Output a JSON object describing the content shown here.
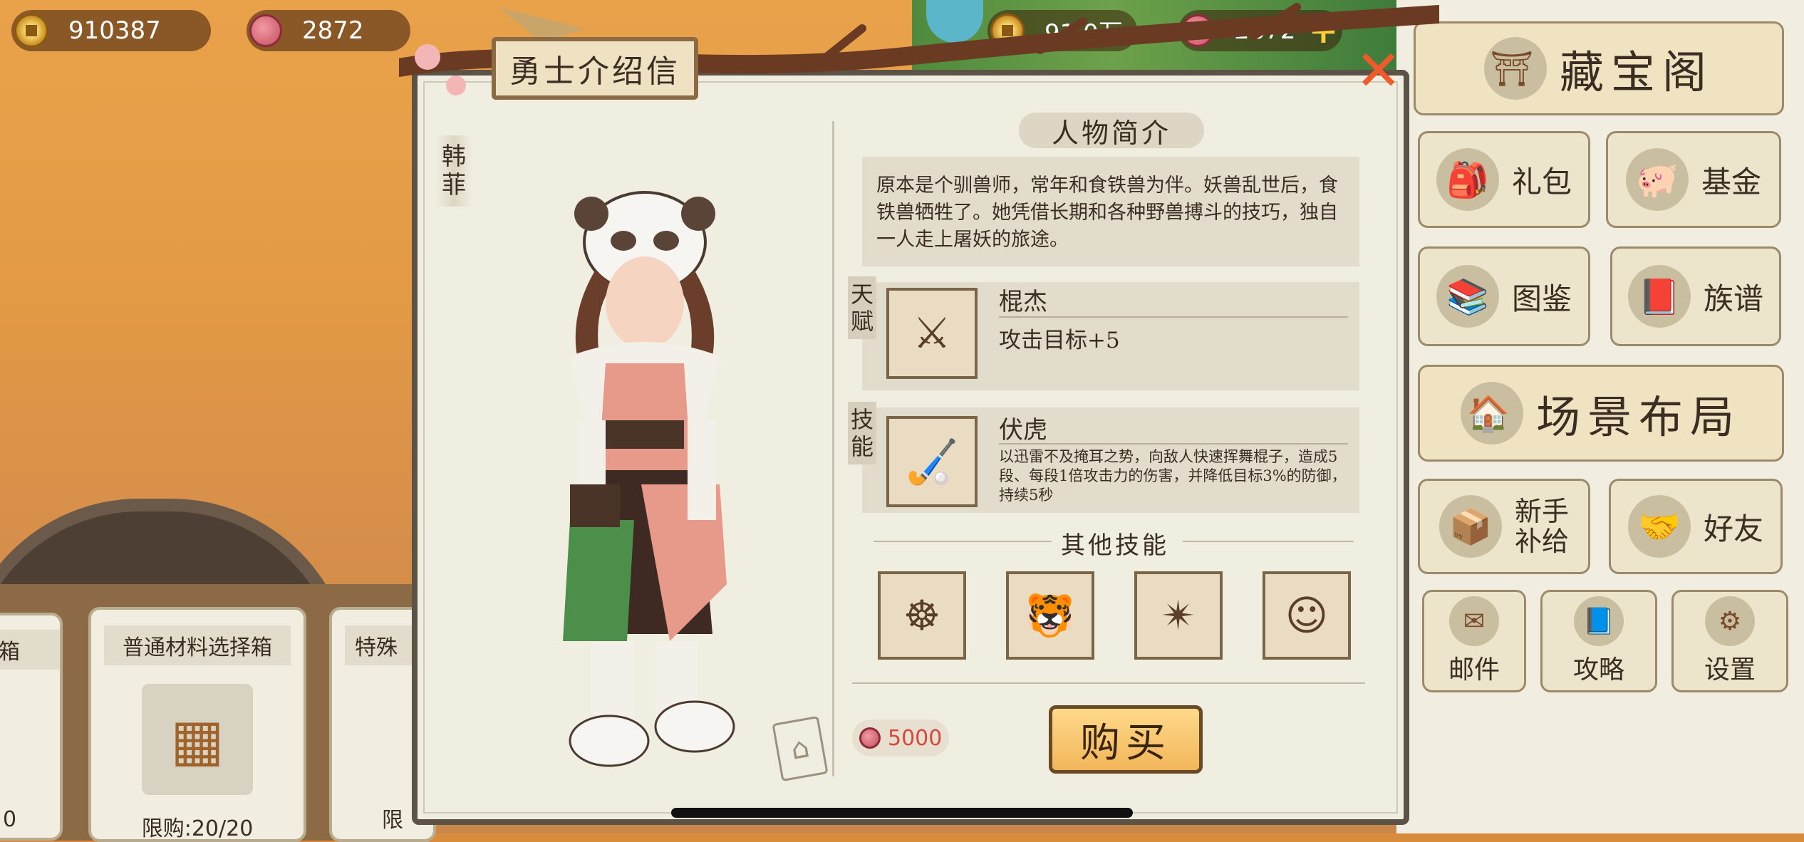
{
  "top_bar": {
    "coins_left": "910387",
    "gems_left": "2872",
    "coins_right": "91.0万",
    "gems_right": "2872",
    "add_icon": "plus-icon"
  },
  "dialog": {
    "title": "勇士介绍信",
    "close_icon": "close-icon",
    "character_name": "韩菲",
    "section_title": "人物简介",
    "bio": "原本是个驯兽师，常年和食铁兽为伴。妖兽乱世后，食铁兽牺牲了。她凭借长期和各种野兽搏斗的技巧，独自一人走上屠妖的旅途。",
    "talent": {
      "tag": "天赋",
      "name": "棍杰",
      "desc": "攻击目标+5"
    },
    "skill": {
      "tag": "技能",
      "name": "伏虎",
      "desc": "以迅雷不及掩耳之势，向敌人快速挥舞棍子，造成5段、每段1倍攻击力的伤害，并降低目标3%的防御，持续5秒"
    },
    "other_skills_title": "其他技能",
    "price": "5000",
    "buy_label": "购买"
  },
  "right_menu": {
    "treasure": "藏宝阁",
    "gift": "礼包",
    "fund": "基金",
    "codex": "图鉴",
    "genealogy": "族谱",
    "layout": "场景布局",
    "newbie_1": "新手",
    "newbie_2": "补给",
    "friends": "好友",
    "mail": "邮件",
    "guide": "攻略",
    "settings": "设置"
  },
  "shop_cards": {
    "card1_title": "普通材料选择箱",
    "card1_limit": "限购:20/20",
    "card2_title": "特殊",
    "card2_limit": "限",
    "card0_title": "箱",
    "card0_limit": "0"
  },
  "colors": {
    "accent": "#f05a2a",
    "price": "#d5483e",
    "buy_button": "#f2b65a"
  }
}
